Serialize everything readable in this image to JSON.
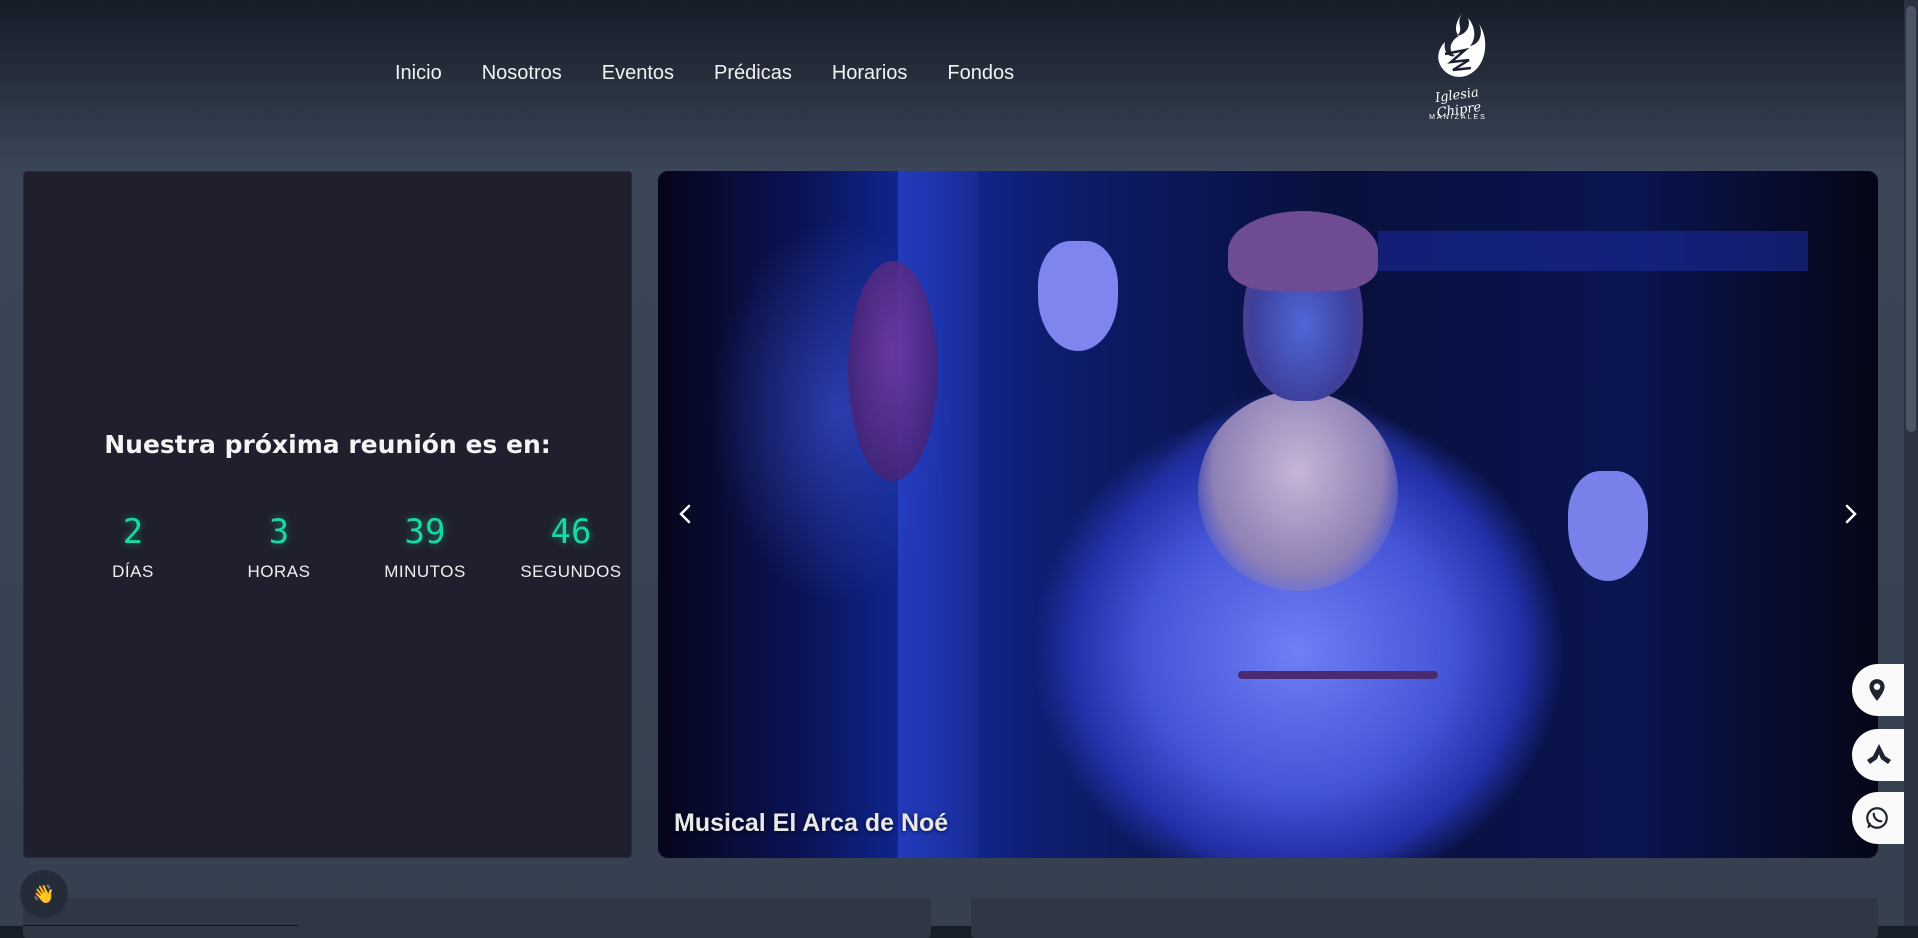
{
  "nav": {
    "items": [
      {
        "label": "Inicio"
      },
      {
        "label": "Nosotros"
      },
      {
        "label": "Eventos"
      },
      {
        "label": "Prédicas"
      },
      {
        "label": "Horarios"
      },
      {
        "label": "Fondos"
      }
    ]
  },
  "logo": {
    "script": "Iglesia Chipre",
    "sub": "MANIZALES",
    "icon": "flame-dove-icon"
  },
  "countdown": {
    "title": "Nuestra próxima reunión es en:",
    "units": [
      {
        "value": "2",
        "label": "DÍAS"
      },
      {
        "value": "3",
        "label": "HORAS"
      },
      {
        "value": "39",
        "label": "MINUTOS"
      },
      {
        "value": "46",
        "label": "SEGUNDOS"
      }
    ],
    "accent_color": "#18d9a1"
  },
  "carousel": {
    "caption": "Musical El Arca de Noé",
    "prev_icon": "chevron-left-icon",
    "next_icon": "chevron-right-icon"
  },
  "floating_actions": [
    {
      "icon": "location-pin-icon"
    },
    {
      "icon": "praying-hands-icon"
    },
    {
      "icon": "whatsapp-icon"
    }
  ],
  "wave_button": {
    "icon": "waving-hand-icon",
    "glyph": "👋"
  }
}
